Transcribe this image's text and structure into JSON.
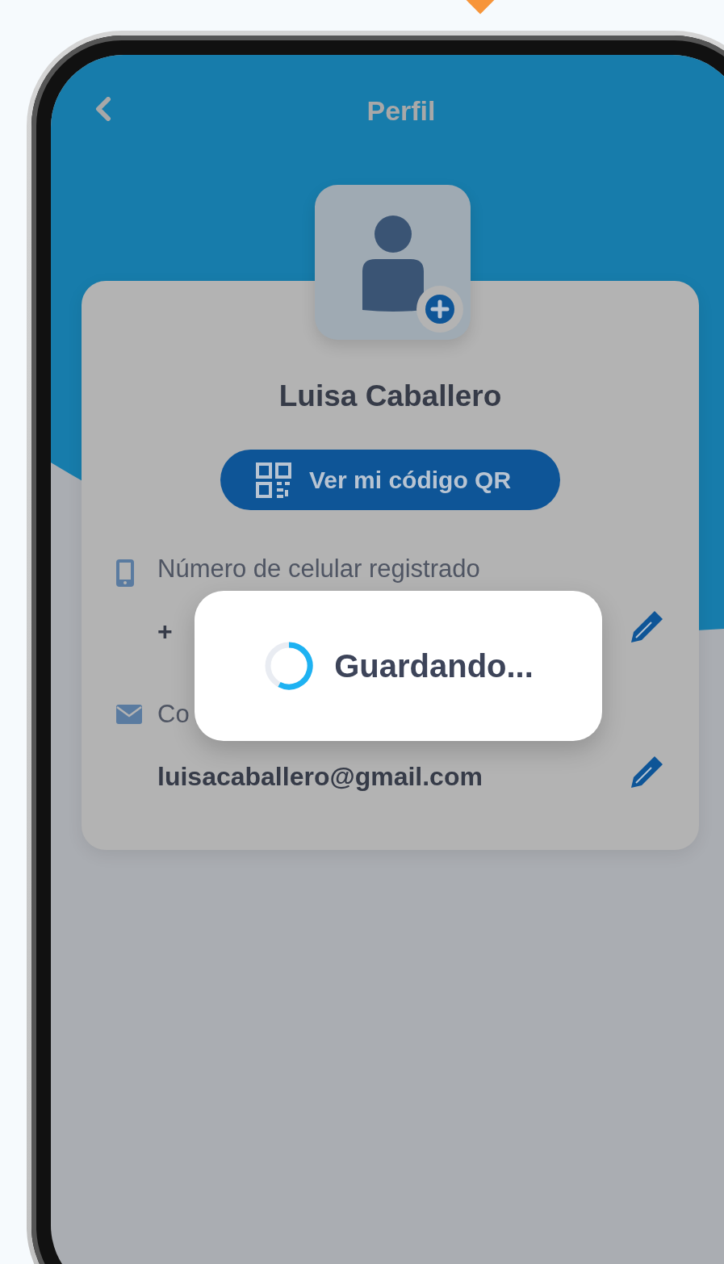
{
  "header": {
    "title": "Perfil"
  },
  "profile": {
    "name": "Luisa Caballero",
    "qr_button": "Ver mi código QR"
  },
  "fields": [
    {
      "kind": "phone",
      "label": "Número de celular registrado",
      "value": "+"
    },
    {
      "kind": "email",
      "label": "Co",
      "value": "luisacaballero@gmail.com"
    }
  ],
  "modal": {
    "message": "Guardando..."
  }
}
